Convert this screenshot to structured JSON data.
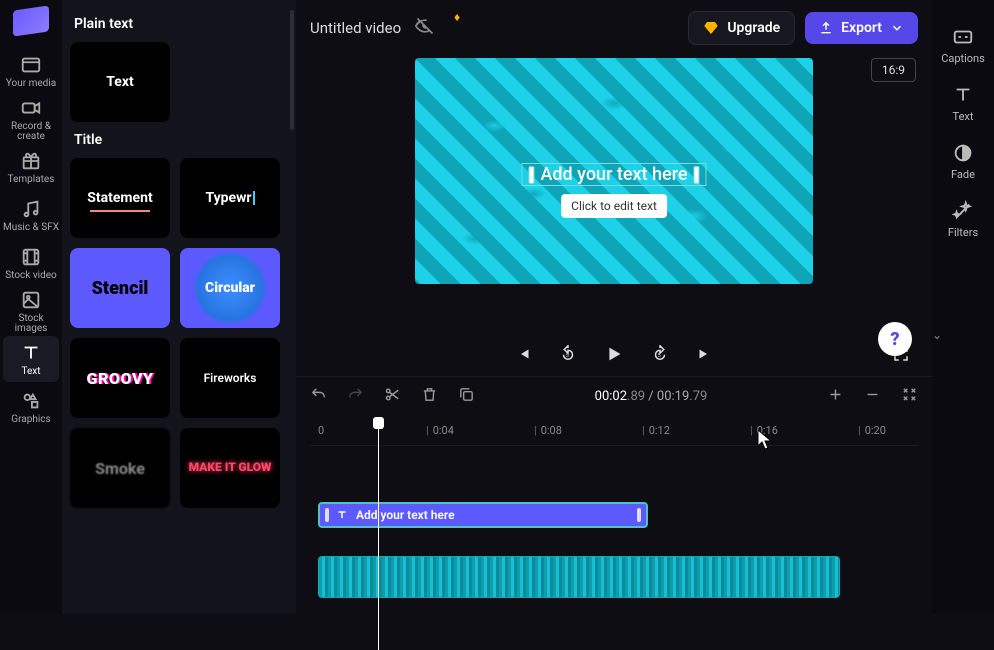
{
  "rail": {
    "items": [
      "Your media",
      "Record & create",
      "Templates",
      "Music & SFX",
      "Stock video",
      "Stock images",
      "Text",
      "Graphics"
    ],
    "active_index": 6
  },
  "panel": {
    "section1": "Plain text",
    "section2": "Title",
    "thumbs": {
      "text": "Text",
      "statement": "Statement",
      "typewriter": "Typewr",
      "stencil": "Stencil",
      "circular": "Circular",
      "groovy": "GROOVY",
      "fireworks": "Fireworks",
      "smoke": "Smoke",
      "glow": "MAKE IT GLOW"
    }
  },
  "header": {
    "title": "Untitled video",
    "upgrade": "Upgrade",
    "export": "Export"
  },
  "canvas": {
    "aspect": "16:9",
    "text_placeholder": "Add your text here",
    "edit_tip": "Click to edit text"
  },
  "time": {
    "current_whole": "00:02",
    "current_frac": ".89",
    "total_whole": "00:19",
    "total_frac": ".79"
  },
  "ruler": {
    "marks": [
      "0",
      "0:04",
      "0:08",
      "0:12",
      "0:16",
      "0:20"
    ]
  },
  "timeline": {
    "text_clip_label": "Add your text here"
  },
  "props": {
    "items": [
      "Captions",
      "Text",
      "Fade",
      "Filters"
    ]
  },
  "colors": {
    "accent": "#5648e8",
    "teal": "#1dd1e8"
  }
}
